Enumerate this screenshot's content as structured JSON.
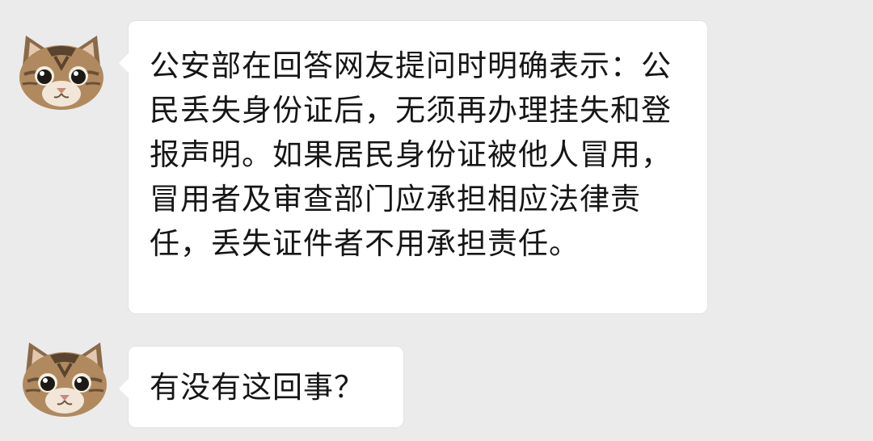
{
  "messages": [
    {
      "sender_avatar": "cat-avatar-icon",
      "text": "公安部在回答网友提问时明确表示：公民丢失身份证后，无须再办理挂失和登报声明。如果居民身份证被他人冒用，冒用者及审查部门应承担相应法律责任，丢失证件者不用承担责任。"
    },
    {
      "sender_avatar": "cat-avatar-icon",
      "text": "有没有这回事？"
    }
  ],
  "colors": {
    "background": "#ebebeb",
    "bubble": "#ffffff",
    "text": "#161616"
  }
}
